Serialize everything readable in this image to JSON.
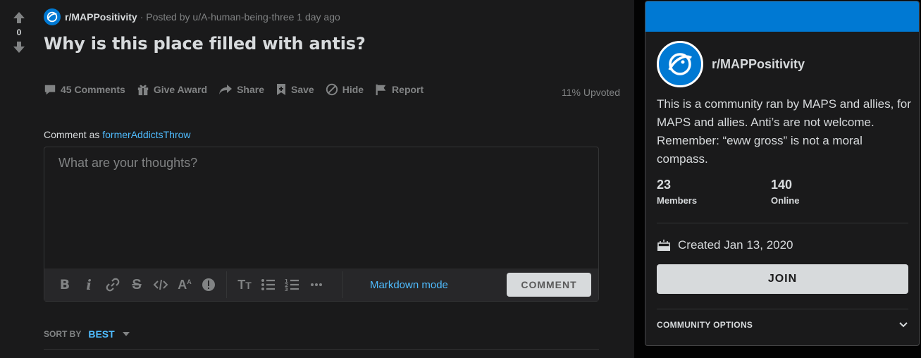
{
  "post": {
    "score": "0",
    "subreddit": "r/MAPPositivity",
    "posted_by": "· Posted by u/A-human-being-three 1 day ago",
    "title": "Why is this place filled with antis?",
    "actions": {
      "comments": "45 Comments",
      "award": "Give Award",
      "share": "Share",
      "save": "Save",
      "hide": "Hide",
      "report": "Report"
    },
    "upvoted": "11% Upvoted"
  },
  "comment_box": {
    "comment_as_label": "Comment as",
    "username": "formerAddictsThrow",
    "placeholder": "What are your thoughts?",
    "markdown_mode": "Markdown mode",
    "comment_button": "COMMENT"
  },
  "sort": {
    "label": "SORT BY",
    "value": "BEST"
  },
  "sidebar": {
    "name": "r/MAPPositivity",
    "description": "This is a community ran by MAPS and allies, for MAPS and allies. Anti’s are not welcome. Remember: “eww gross” is not a moral compass.",
    "members_count": "23",
    "members_label": "Members",
    "online_count": "140",
    "online_label": "Online",
    "created": "Created Jan 13, 2020",
    "join_button": "JOIN",
    "community_options": "COMMUNITY OPTIONS"
  },
  "colors": {
    "accent": "#0079d3",
    "link": "#4fbcff",
    "background": "#1a1a1b"
  },
  "icons": [
    "upvote-icon",
    "downvote-icon",
    "comment-icon",
    "gift-icon",
    "share-icon",
    "save-icon",
    "hide-icon",
    "report-icon",
    "bold-icon",
    "italic-icon",
    "link-icon",
    "strikethrough-icon",
    "code-icon",
    "superscript-icon",
    "spoiler-icon",
    "heading-icon",
    "bulleted-list-icon",
    "numbered-list-icon",
    "more-icon",
    "cake-icon",
    "chevron-down-icon",
    "planet-icon"
  ]
}
